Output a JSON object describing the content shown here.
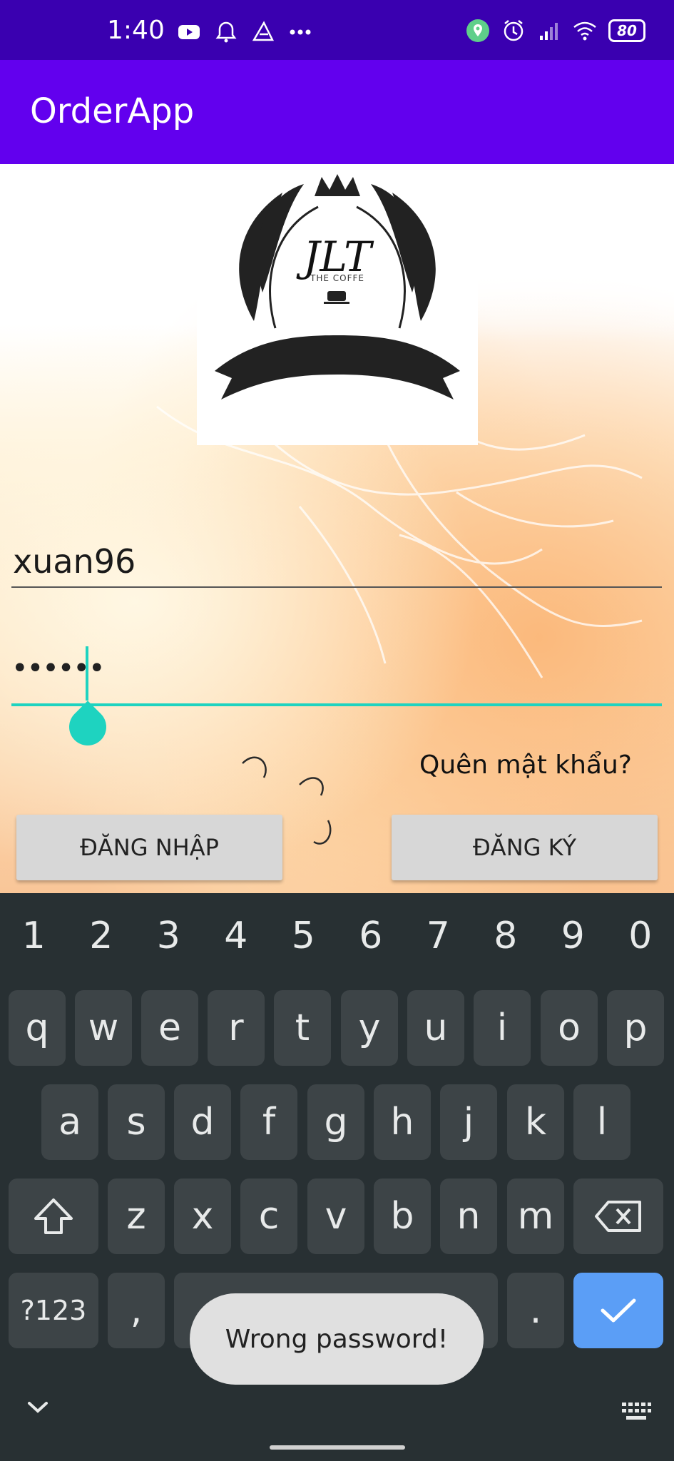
{
  "status_bar": {
    "time": "1:40",
    "battery": "80",
    "icons_left": [
      "youtube-icon",
      "bell-icon",
      "paper-plane-icon",
      "more-dots-icon"
    ],
    "icons_right": [
      "location-icon",
      "alarm-icon",
      "signal-icon",
      "wifi-icon",
      "battery-icon"
    ]
  },
  "app_bar": {
    "title": "OrderApp"
  },
  "logo": {
    "script_text": "JLT",
    "subtitle": "THE COFFE"
  },
  "form": {
    "username_value": "xuan96",
    "password_value": "••••••",
    "forgot_link": "Quên mật khẩu?",
    "login_button": "ĐĂNG NHẬP",
    "register_button": "ĐĂNG KÝ"
  },
  "keyboard": {
    "number_row": [
      "1",
      "2",
      "3",
      "4",
      "5",
      "6",
      "7",
      "8",
      "9",
      "0"
    ],
    "row1": [
      "q",
      "w",
      "e",
      "r",
      "t",
      "y",
      "u",
      "i",
      "o",
      "p"
    ],
    "row2": [
      "a",
      "s",
      "d",
      "f",
      "g",
      "h",
      "j",
      "k",
      "l"
    ],
    "row3": [
      "z",
      "x",
      "c",
      "v",
      "b",
      "n",
      "m"
    ],
    "symbols_key": "?123",
    "comma_key": ",",
    "period_key": "."
  },
  "toast": {
    "message": "Wrong password!"
  },
  "colors": {
    "status_bar": "#3a00b0",
    "app_bar": "#6200ee",
    "accent": "#1ed3c0",
    "keyboard_bg": "#283033",
    "key_bg": "#3d4447",
    "enter_key": "#5b9ef6"
  }
}
